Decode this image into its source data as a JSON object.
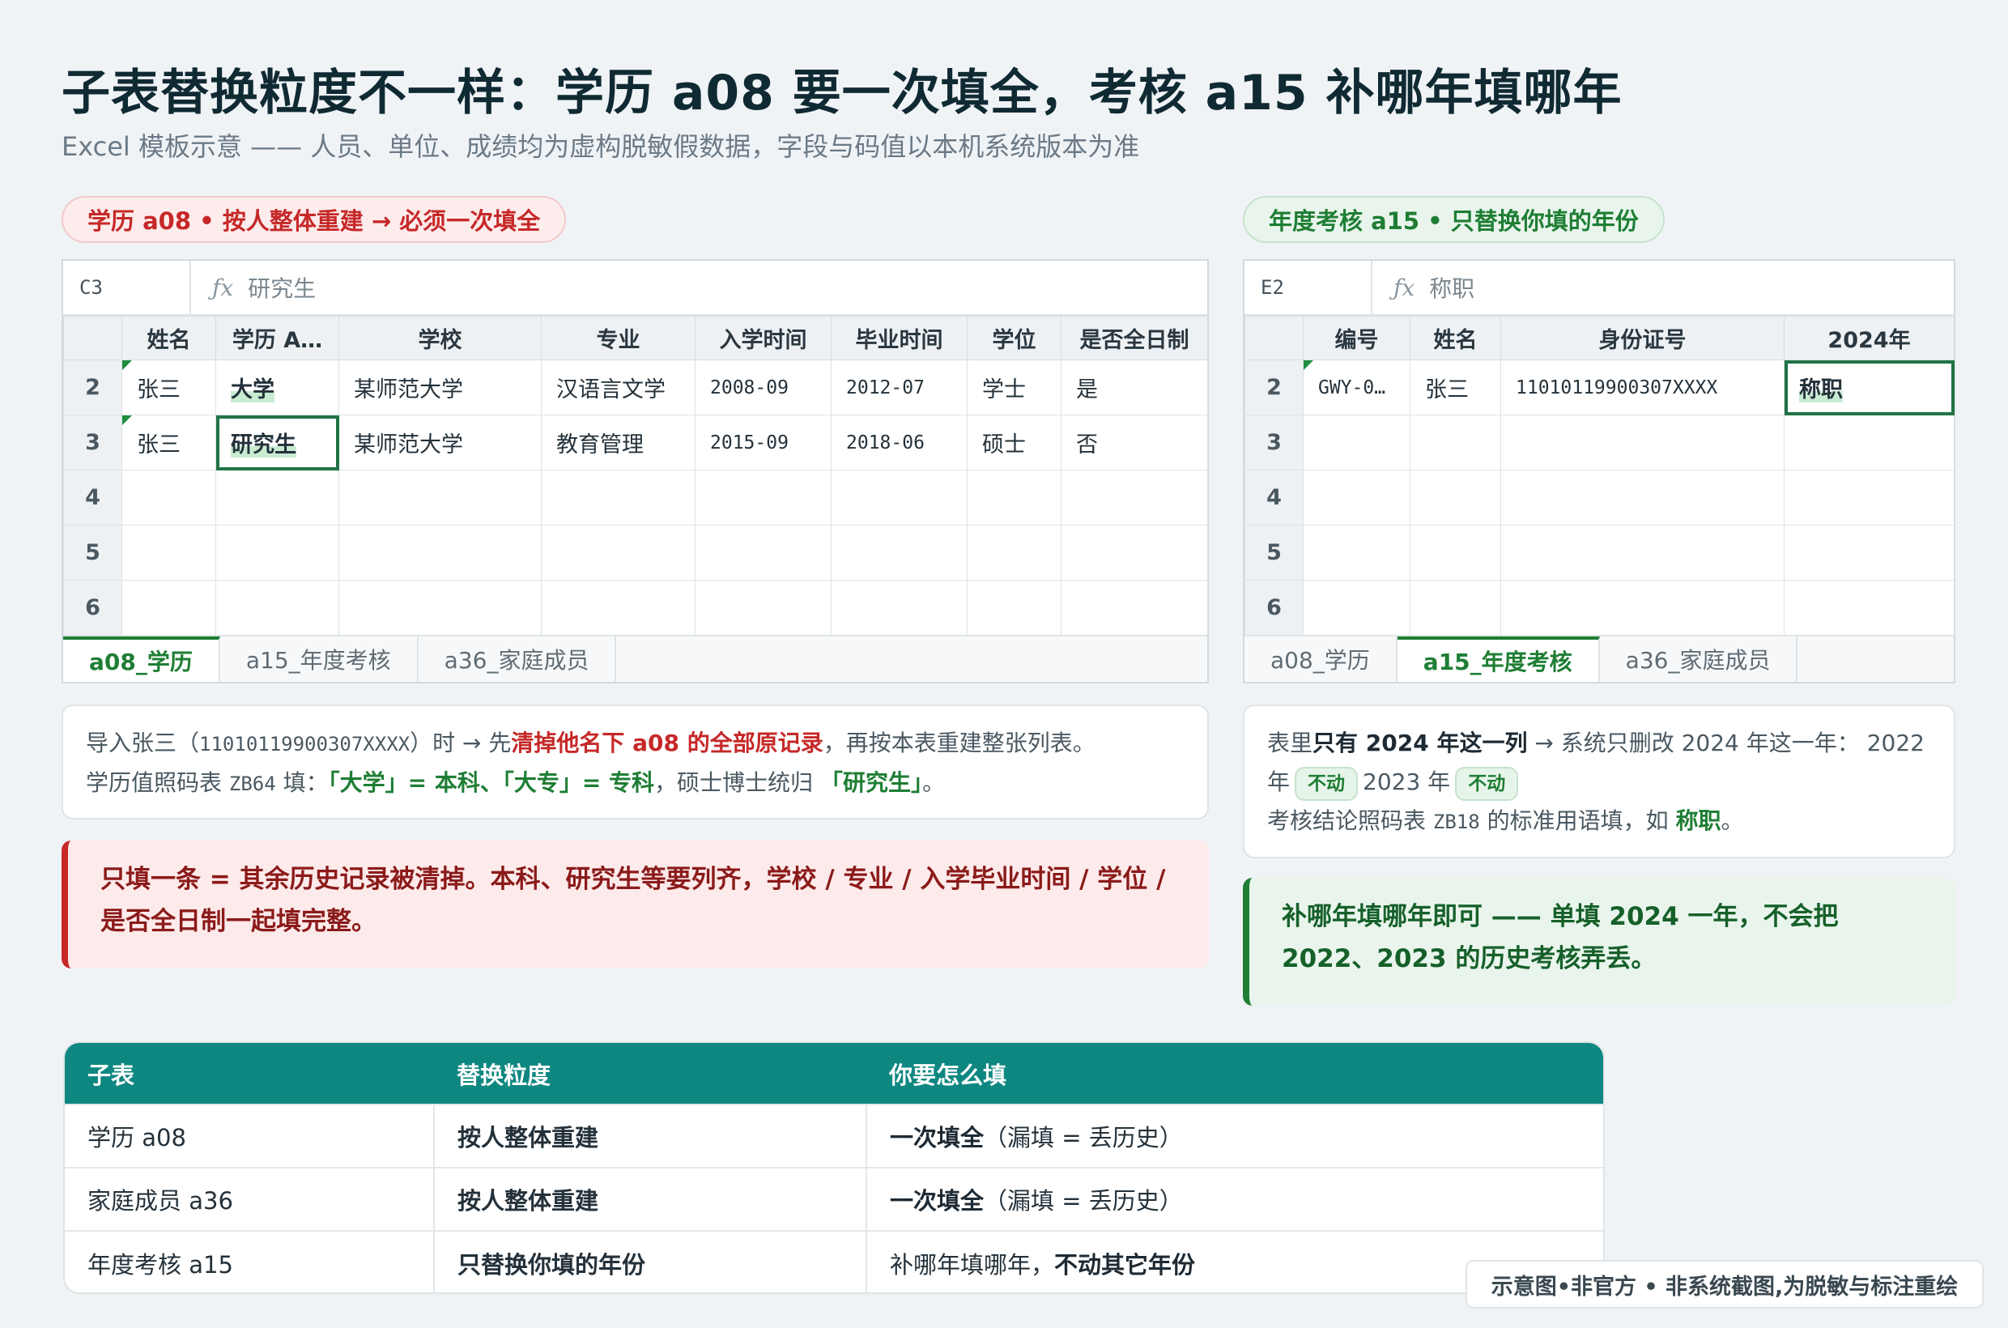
{
  "title": "子表替换粒度不一样：学历 a08 要一次填全，考核 a15 补哪年填哪年",
  "subtitle": "Excel 模板示意 —— 人员、单位、成绩均为虚构脱敏假数据，字段与码值以本机系统版本为准",
  "left_pill": "学历 a08 • 按人整体重建 → 必须一次填全",
  "right_pill": "年度考核 a15 • 只替换你填的年份",
  "left_sheet": {
    "namebox": "C3",
    "fx_symbol": "ƒx",
    "formula": "研究生",
    "headers": [
      "姓名",
      "学历 A…",
      "学校",
      "专业",
      "入学时间",
      "毕业时间",
      "学位",
      "是否全日制"
    ],
    "row_numbers": [
      "2",
      "3",
      "4",
      "5",
      "6"
    ],
    "rows": [
      [
        "张三",
        "大学",
        "某师范大学",
        "汉语言文学",
        "2008-09",
        "2012-07",
        "学士",
        "是"
      ],
      [
        "张三",
        "研究生",
        "某师范大学",
        "教育管理",
        "2015-09",
        "2018-06",
        "硕士",
        "否"
      ]
    ],
    "tabs": [
      "a08_学历",
      "a15_年度考核",
      "a36_家庭成员"
    ]
  },
  "right_sheet": {
    "namebox": "E2",
    "fx_symbol": "ƒx",
    "formula": "称职",
    "headers": [
      "编号",
      "姓名",
      "身份证号",
      "2024年"
    ],
    "row_numbers": [
      "2",
      "3",
      "4",
      "5",
      "6"
    ],
    "rows": [
      [
        "GWY-0…",
        "张三",
        "11010119900307XXXX",
        "称职"
      ]
    ],
    "tabs": [
      "a08_学历",
      "a15_年度考核",
      "a36_家庭成员"
    ]
  },
  "left_note": {
    "l1_a": "导入张三（",
    "l1_id": "11010119900307XXXX",
    "l1_b": "）时 → 先",
    "l1_red": "清掉他名下 a08 的全部原记录",
    "l1_c": "，再按本表重建整张列表。",
    "l2_a": "学历值照码表 ",
    "l2_code": "ZB64",
    "l2_b": " 填：",
    "l2_g1": "「大学」= 本科、「大专」= 专科",
    "l2_c": "，硕士博士统归 ",
    "l2_g2": "「研究生」",
    "l2_d": "。"
  },
  "right_note": {
    "l1_a": "表里",
    "l1_bold": "只有 2024 年这一列",
    "l1_b": " → 系统只删改 2024 年这一年：",
    "y2022": "2022 年",
    "chip1": "不动",
    "y2023": "2023 年",
    "chip2": "不动",
    "l3_a": "考核结论照码表 ",
    "l3_code": "ZB18",
    "l3_b": " 的标准用语填，如 ",
    "l3_green": "称职",
    "l3_c": "。"
  },
  "left_callout": "只填一条 = 其余历史记录被清掉。本科、研究生等要列齐，学校 / 专业 / 入学毕业时间 / 学位 / 是否全日制一起填完整。",
  "right_callout": "补哪年填哪年即可 —— 单填 2024 一年，不会把 2022、2023 的历史考核弄丢。",
  "summary": {
    "headers": [
      "子表",
      "替换粒度",
      "你要怎么填"
    ],
    "rows": [
      {
        "table": "学历 a08",
        "granularity": "按人整体重建",
        "how_bold": "一次填全",
        "how_rest": "（漏填 = 丢历史）"
      },
      {
        "table": "家庭成员 a36",
        "granularity": "按人整体重建",
        "how_bold": "一次填全",
        "how_rest": "（漏填 = 丢历史）"
      },
      {
        "table": "年度考核 a15",
        "granularity": "只替换你填的年份",
        "how_rest": "补哪年填哪年，",
        "how_bold": "不动其它年份"
      }
    ]
  },
  "badge": "示意图•非官方 • 非系统截图,为脱敏与标注重绘",
  "colors": {
    "red": "#c62828",
    "green": "#1e7e34",
    "teal": "#0e8781",
    "excel_green": "#217346"
  }
}
